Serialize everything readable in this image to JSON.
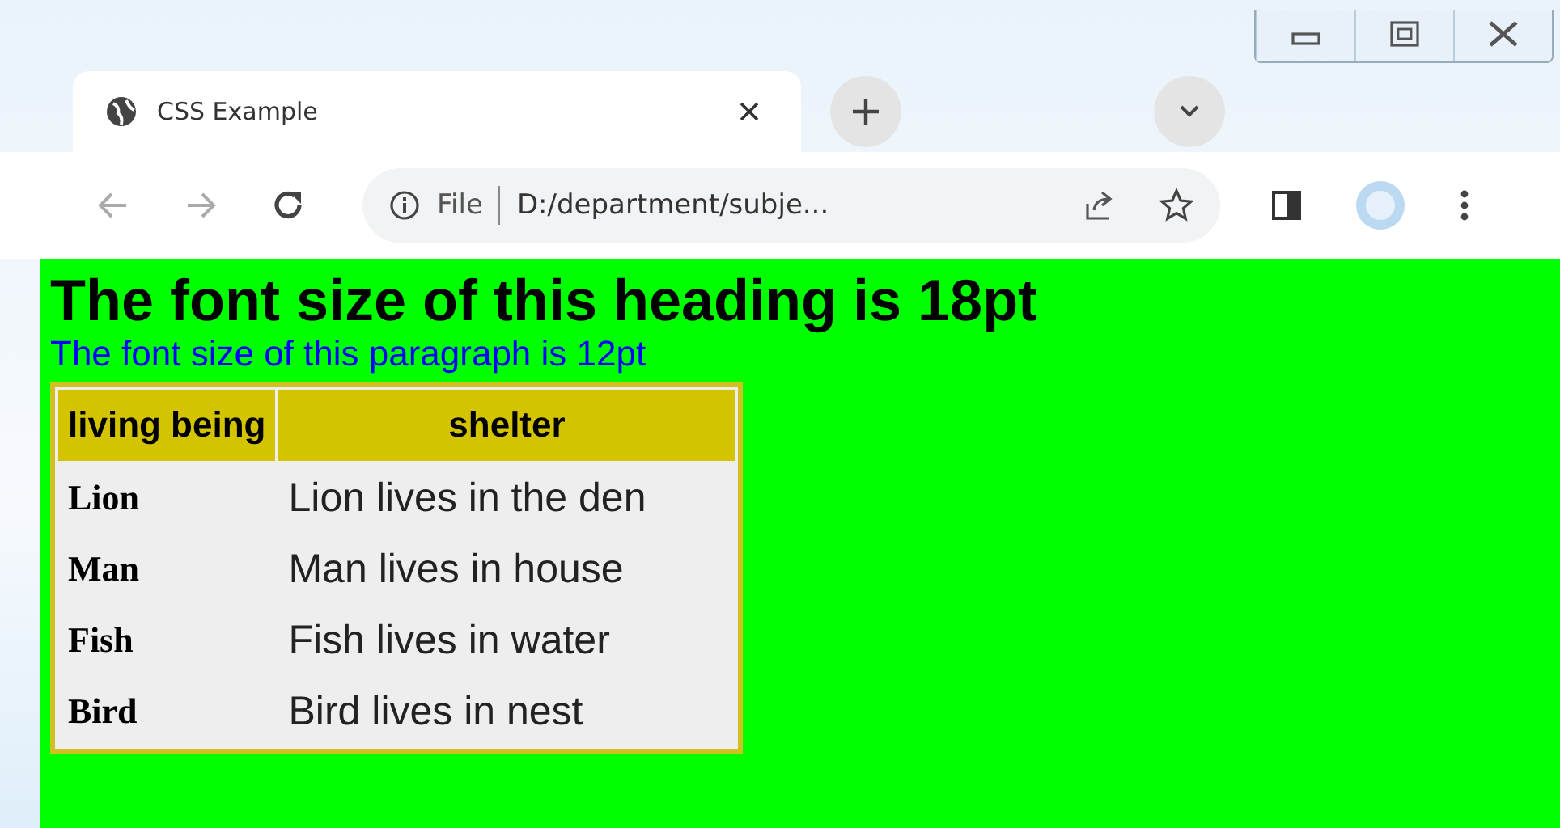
{
  "tab": {
    "title": "CSS Example"
  },
  "address_bar": {
    "scheme_label": "File",
    "url": "D:/department/subje..."
  },
  "page": {
    "heading": "The font size of this heading is 18pt",
    "paragraph": "The font size of this paragraph is 12pt",
    "table": {
      "columns": [
        "living being",
        "shelter"
      ],
      "rows": [
        {
          "being": "Lion",
          "shelter": "Lion lives in the den"
        },
        {
          "being": "Man",
          "shelter": "Man lives in house"
        },
        {
          "being": "Fish",
          "shelter": "Fish lives in water"
        },
        {
          "being": "Bird",
          "shelter": "Bird lives in nest"
        }
      ]
    }
  }
}
